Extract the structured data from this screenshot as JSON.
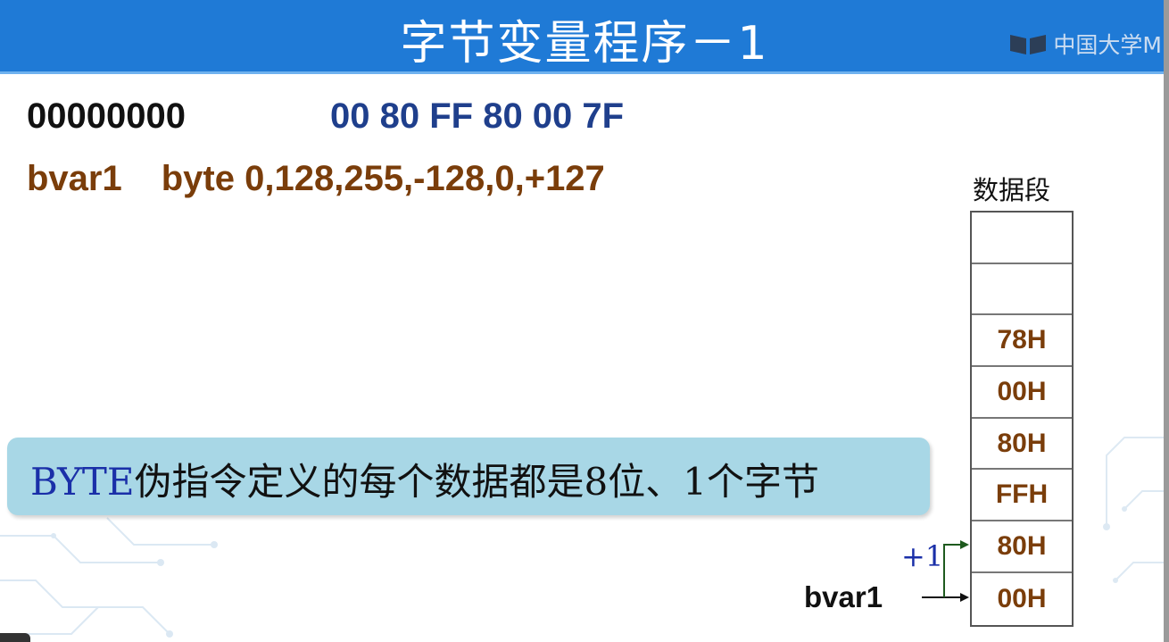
{
  "title": "字节变量程序－1",
  "logo": {
    "text": "中国大学M"
  },
  "line1": {
    "zeros": "00000000",
    "hex": "00 80 FF 80 00 7F"
  },
  "line2": {
    "label": "bvar1",
    "statement": "byte 0,128,255,-128,0,+127"
  },
  "note": {
    "keyword": "BYTE",
    "text": "伪指令定义的每个数据都是8位、1个字节"
  },
  "memory": {
    "label": "数据段",
    "cells": [
      "",
      "",
      "78H",
      "00H",
      "80H",
      "FFH",
      "80H",
      "00H"
    ]
  },
  "pointer": {
    "label": "bvar1",
    "increment": "+1"
  }
}
